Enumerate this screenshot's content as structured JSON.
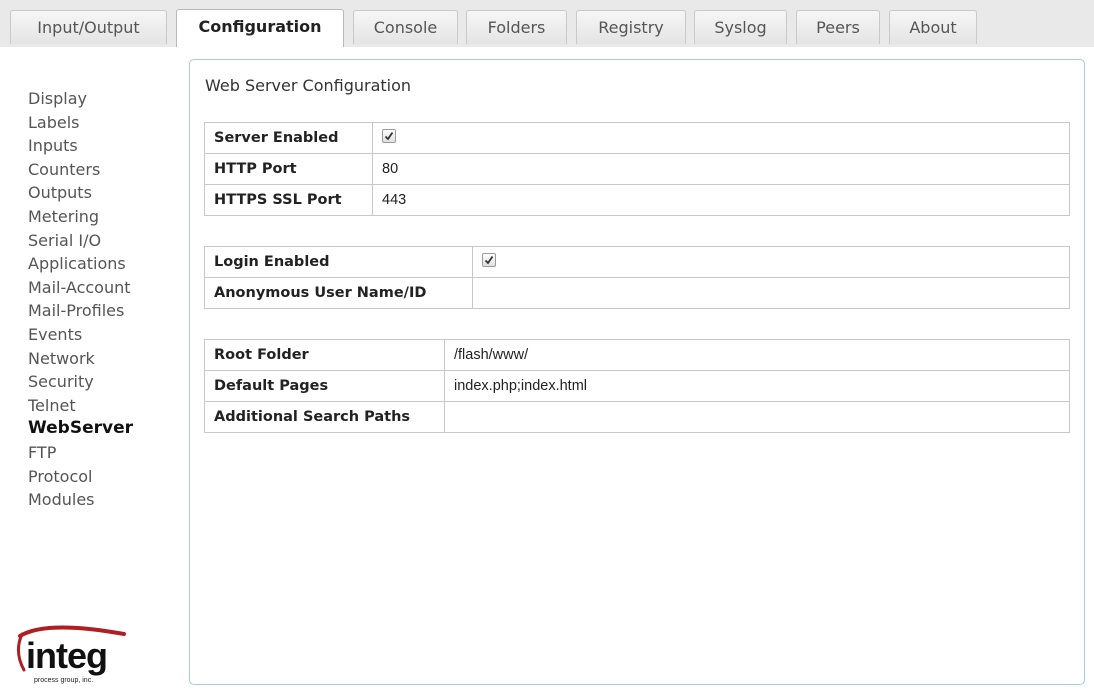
{
  "tabs": [
    {
      "label": "Input/Output",
      "active": false
    },
    {
      "label": "Configuration",
      "active": true
    },
    {
      "label": "Console",
      "active": false
    },
    {
      "label": "Folders",
      "active": false
    },
    {
      "label": "Registry",
      "active": false
    },
    {
      "label": "Syslog",
      "active": false
    },
    {
      "label": "Peers",
      "active": false
    },
    {
      "label": "About",
      "active": false
    }
  ],
  "sidebar": {
    "items": [
      {
        "label": "Display"
      },
      {
        "label": "Labels"
      },
      {
        "label": "Inputs"
      },
      {
        "label": "Counters"
      },
      {
        "label": "Outputs"
      },
      {
        "label": "Metering"
      },
      {
        "label": "Serial I/O"
      },
      {
        "label": "Applications"
      },
      {
        "label": "Mail-Account"
      },
      {
        "label": "Mail-Profiles"
      },
      {
        "label": "Events"
      },
      {
        "label": "Network"
      },
      {
        "label": "Security"
      },
      {
        "label": "Telnet"
      },
      {
        "label": "WebServer",
        "active": true
      },
      {
        "label": "FTP"
      },
      {
        "label": "Protocol"
      },
      {
        "label": "Modules"
      }
    ]
  },
  "logo": {
    "name": "integ",
    "tagline": "process group, inc.",
    "color": "#b01e24"
  },
  "main": {
    "title": "Web Server Configuration",
    "server": {
      "enabled_label": "Server Enabled",
      "enabled": true,
      "http_port_label": "HTTP Port",
      "http_port": "80",
      "https_port_label": "HTTPS SSL Port",
      "https_port": "443"
    },
    "login": {
      "enabled_label": "Login Enabled",
      "enabled": true,
      "anon_label": "Anonymous User Name/ID",
      "anon_value": ""
    },
    "paths": {
      "root_label": "Root Folder",
      "root_value": "/flash/www/",
      "default_label": "Default Pages",
      "default_value": "index.php;index.html",
      "additional_label": "Additional Search Paths",
      "additional_value": ""
    }
  }
}
